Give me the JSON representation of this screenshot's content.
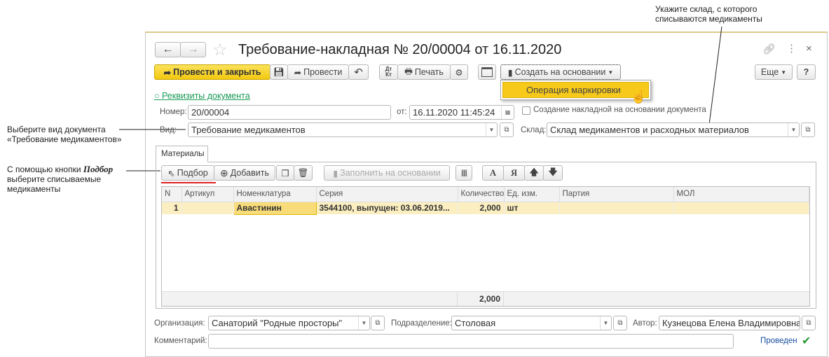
{
  "annotations": {
    "sklad": [
      "Укажите склад, с которого",
      "списываются медикаменты"
    ],
    "vid": [
      "Выберите вид документа",
      "«Требование медикаментов»"
    ],
    "podbor_pre": "С помощью кнопки ",
    "podbor_bold": "Подбор",
    "podbor_rest": [
      "выберите списываемые",
      "медикаменты"
    ]
  },
  "window": {
    "title": "Требование-накладная № 20/00004 от 16.11.2020"
  },
  "toolbar": {
    "post_close": "Провести и закрыть",
    "post": "Провести",
    "dtkt": "Дт Кт",
    "print": "Печать",
    "create_based": "Создать на основании",
    "more": "Еще",
    "help": "?"
  },
  "dropdown": {
    "item": "Операция маркировки"
  },
  "form": {
    "details_link": "○ Реквизиты документа",
    "number_label": "Номер:",
    "number": "20/00004",
    "date_label": "от:",
    "date": "16.11.2020  11:45:24",
    "checkbox_label": "Создание накладной на основании документа",
    "kind_label": "Вид:",
    "kind": "Требование медикаментов",
    "warehouse_label": "Склад:",
    "warehouse": "Склад медикаментов и расходных материалов"
  },
  "tab": "Материалы",
  "table_toolbar": {
    "pick": "Подбор",
    "add": "Добавить",
    "fill": "Заполнить на основании",
    "A": "А",
    "Ya": "Я"
  },
  "table": {
    "columns": [
      "N",
      "Артикул",
      "Номенклатура",
      "Серия",
      "Количество",
      "Ед. изм.",
      "Партия",
      "МОЛ"
    ],
    "rows": [
      [
        "1",
        "",
        "Авастинин",
        "3544100, выпущен: 03.06.2019...",
        "2,000",
        "шт",
        "",
        ""
      ]
    ],
    "total_qty": "2,000"
  },
  "footer": {
    "org_label": "Организация:",
    "org": "Санаторий \"Родные просторы\"",
    "dept_label": "Подразделение:",
    "dept": "Столовая",
    "author_label": "Автор:",
    "author": "Кузнецова Елена Владимировна",
    "comment_label": "Комментарий:",
    "comment": "",
    "status": "Проведен"
  }
}
